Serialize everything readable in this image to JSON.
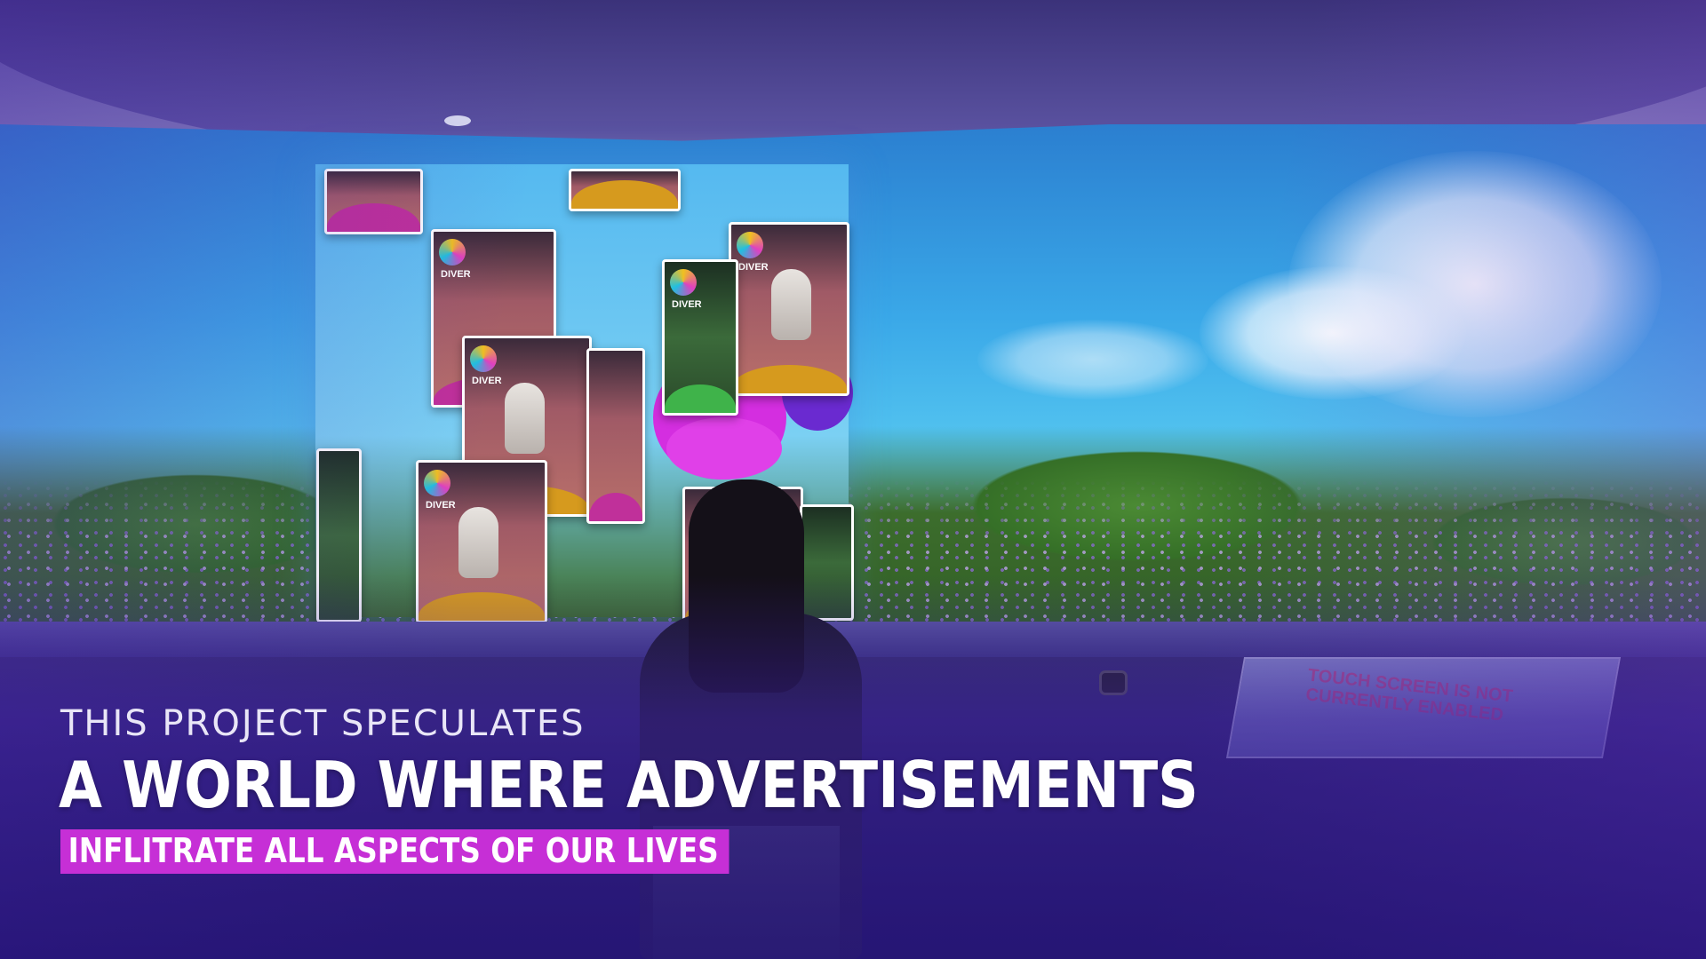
{
  "caption": {
    "line1": "THIS PROJECT SPECULATES",
    "line2": "A WORLD WHERE ADVERTISEMENTS",
    "line3": "INFLITRATE ALL ASPECTS OF OUR LIVES"
  },
  "screen": {
    "touch_notice": "TOUCH SCREEN IS NOT CURRENTLY ENABLED"
  },
  "ad_cards": [
    {
      "brand": "DIVER"
    },
    {
      "brand": "DIVER"
    },
    {
      "brand": "DIVER"
    },
    {
      "brand": "DIVER"
    },
    {
      "brand": "DIVER"
    }
  ],
  "colors": {
    "highlight": "#c62fd6",
    "overlay": "#3c1ea0"
  }
}
